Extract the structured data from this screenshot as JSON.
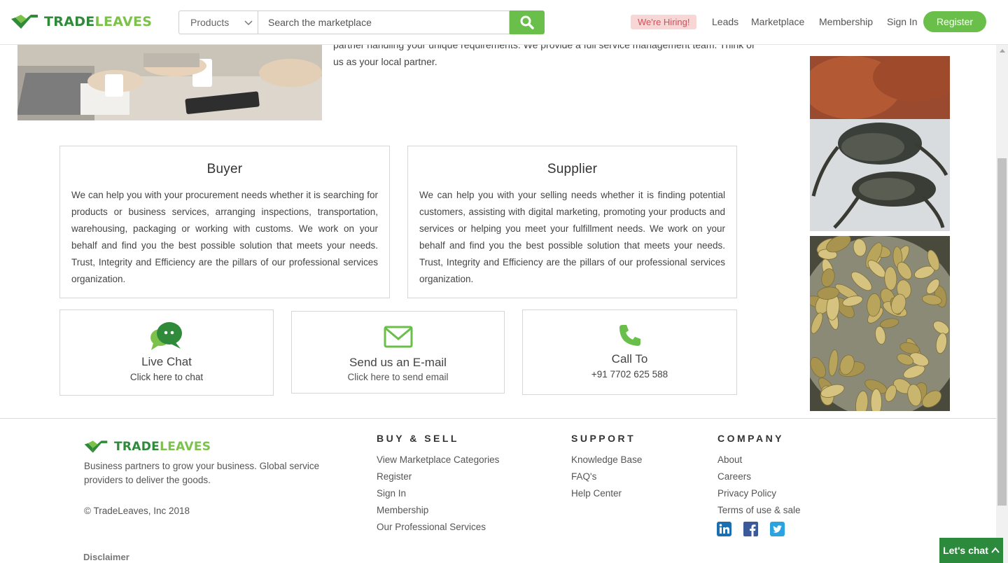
{
  "header": {
    "logo": {
      "part1": "TRADE",
      "part2": "LEAVES"
    },
    "category_select": "Products",
    "search_placeholder": "Search the marketplace",
    "hiring_badge": "We're Hiring!",
    "nav": [
      "Leads",
      "Marketplace",
      "Membership",
      "Sign In"
    ],
    "register": "Register"
  },
  "intro": {
    "text_line1": "partner handling your unique requirements. We provide a full service management team. Think of",
    "text_line2": "us as your local partner."
  },
  "cards": [
    {
      "title": "Buyer",
      "body": "We can help you with your procurement needs whether it is searching for products or business services, arranging inspections, transportation, warehousing, packaging or working with customs. We work on your behalf and find you the best possible solution that meets your needs. Trust, Integrity and Efficiency are the pillars of our professional services organization."
    },
    {
      "title": "Supplier",
      "body": "We can help you with your selling needs whether it is finding potential customers, assisting with digital marketing, promoting your products and services or helping you meet your fulfillment needs. We work on your behalf and find you the best possible solution that meets your needs. Trust, Integrity and Efficiency are the pillars of our professional services organization."
    }
  ],
  "contacts": [
    {
      "title": "Live Chat",
      "sub": "Click here to chat",
      "icon": "chat-bubbles-icon"
    },
    {
      "title": "Send us an E-mail",
      "sub": "Click here to send email",
      "icon": "envelope-icon"
    },
    {
      "title": "Call To",
      "sub": "+91 7702 625 588",
      "icon": "phone-icon"
    }
  ],
  "footer": {
    "logo": {
      "part1": "TRADE",
      "part2": "LEAVES"
    },
    "tagline": "Business partners to grow your business. Global service providers to deliver the goods.",
    "copyright": "© TradeLeaves, Inc 2018",
    "disclaimer": "Disclaimer",
    "columns": [
      {
        "heading": "BUY & SELL",
        "links": [
          "View Marketplace Categories",
          "Register",
          "Sign In",
          "Membership",
          "Our Professional Services"
        ]
      },
      {
        "heading": "SUPPORT",
        "links": [
          "Knowledge Base",
          "FAQ's",
          "Help Center"
        ]
      },
      {
        "heading": "COMPANY",
        "links": [
          "About",
          "Careers",
          "Privacy Policy",
          "Terms of use & sale"
        ]
      }
    ],
    "social": [
      "linkedin-icon",
      "facebook-icon",
      "twitter-icon"
    ]
  },
  "chat_widget": {
    "label": "Let's chat"
  },
  "colors": {
    "brand_green": "#6abf4b",
    "brand_dark_green": "#2f8a3a",
    "hiring_bg": "#f8d6d6",
    "hiring_text": "#d1505a",
    "chat_widget": "#2c8a3d"
  }
}
